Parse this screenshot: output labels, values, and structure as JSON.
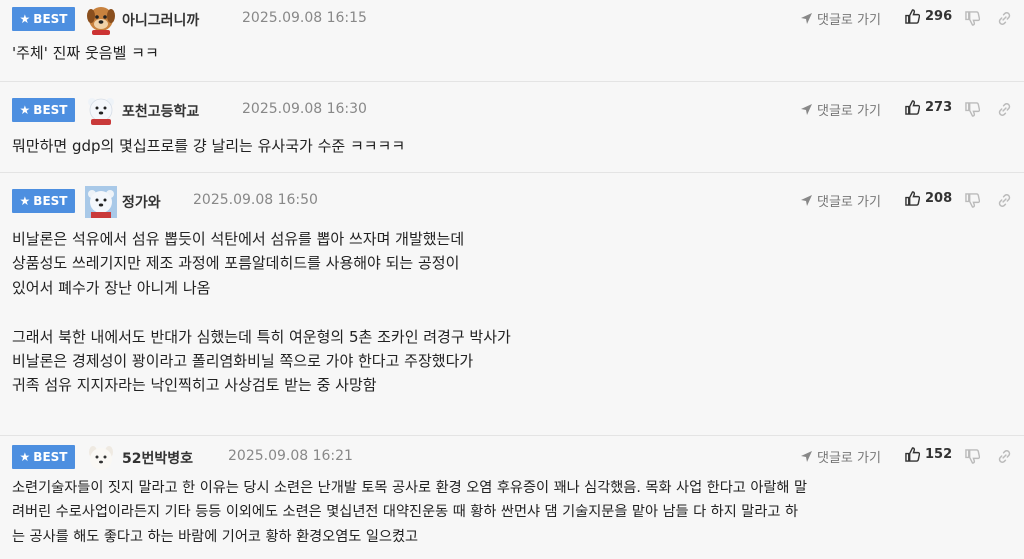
{
  "labels": {
    "best": "BEST",
    "reply": "댓글로 가기"
  },
  "colors": {
    "best_badge": "#4d8fe0",
    "background": "#f7f7f7",
    "date_text": "#888888"
  },
  "comments": [
    {
      "nick": "아니그러니까",
      "avatar_icon": "dog-avatar-icon",
      "date": "2025.09.08 16:15",
      "likes": "296",
      "lines": [
        "'주체' 진짜 웃음벨 ㅋㅋ"
      ]
    },
    {
      "nick": "포천고등학교",
      "avatar_icon": "polar-bear-avatar-icon",
      "date": "2025.09.08 16:30",
      "likes": "273",
      "lines": [
        "뭐만하면 gdp의 몇십프로를 걍 날리는 유사국가 수준 ㅋㅋㅋㅋ"
      ]
    },
    {
      "nick": "정가와",
      "avatar_icon": "polar-bear-avatar-icon",
      "date": "2025.09.08 16:50",
      "likes": "208",
      "lines": [
        "비날론은 석유에서 섬유 뽑듯이 석탄에서 섬유를 뽑아 쓰자며 개발했는데",
        "상품성도 쓰레기지만 제조 과정에 포름알데히드를 사용해야 되는 공정이",
        "있어서 폐수가 장난 아니게 나옴",
        "",
        "그래서 북한 내에서도 반대가 심했는데 특히 여운형의 5촌 조카인 려경구 박사가",
        "비날론은 경제성이 꽝이라고 폴리염화비닐 쪽으로 가야 한다고 주장했다가",
        "귀족 섬유 지지자라는 낙인찍히고 사상검토 받는 중 사망함"
      ]
    },
    {
      "nick": "52번박병호",
      "avatar_icon": "white-dog-avatar-icon",
      "date": "2025.09.08 16:21",
      "likes": "152",
      "lines": [
        "소련기술자들이 짓지 말라고 한 이유는 당시 소련은 난개발 토목 공사로 환경 오염 후유증이 꽤나 심각했음. 목화 사업 한다고 아랄해 말",
        "려버린 수로사업이라든지 기타 등등 이외에도 소련은 몇십년전 대약진운동 때 황하 싼먼샤 댐 기술지문을 맡아 남들 다 하지 말라고 하",
        "는 공사를 해도 좋다고 하는 바람에 기어코 황하 환경오염도 일으켰고"
      ]
    }
  ]
}
